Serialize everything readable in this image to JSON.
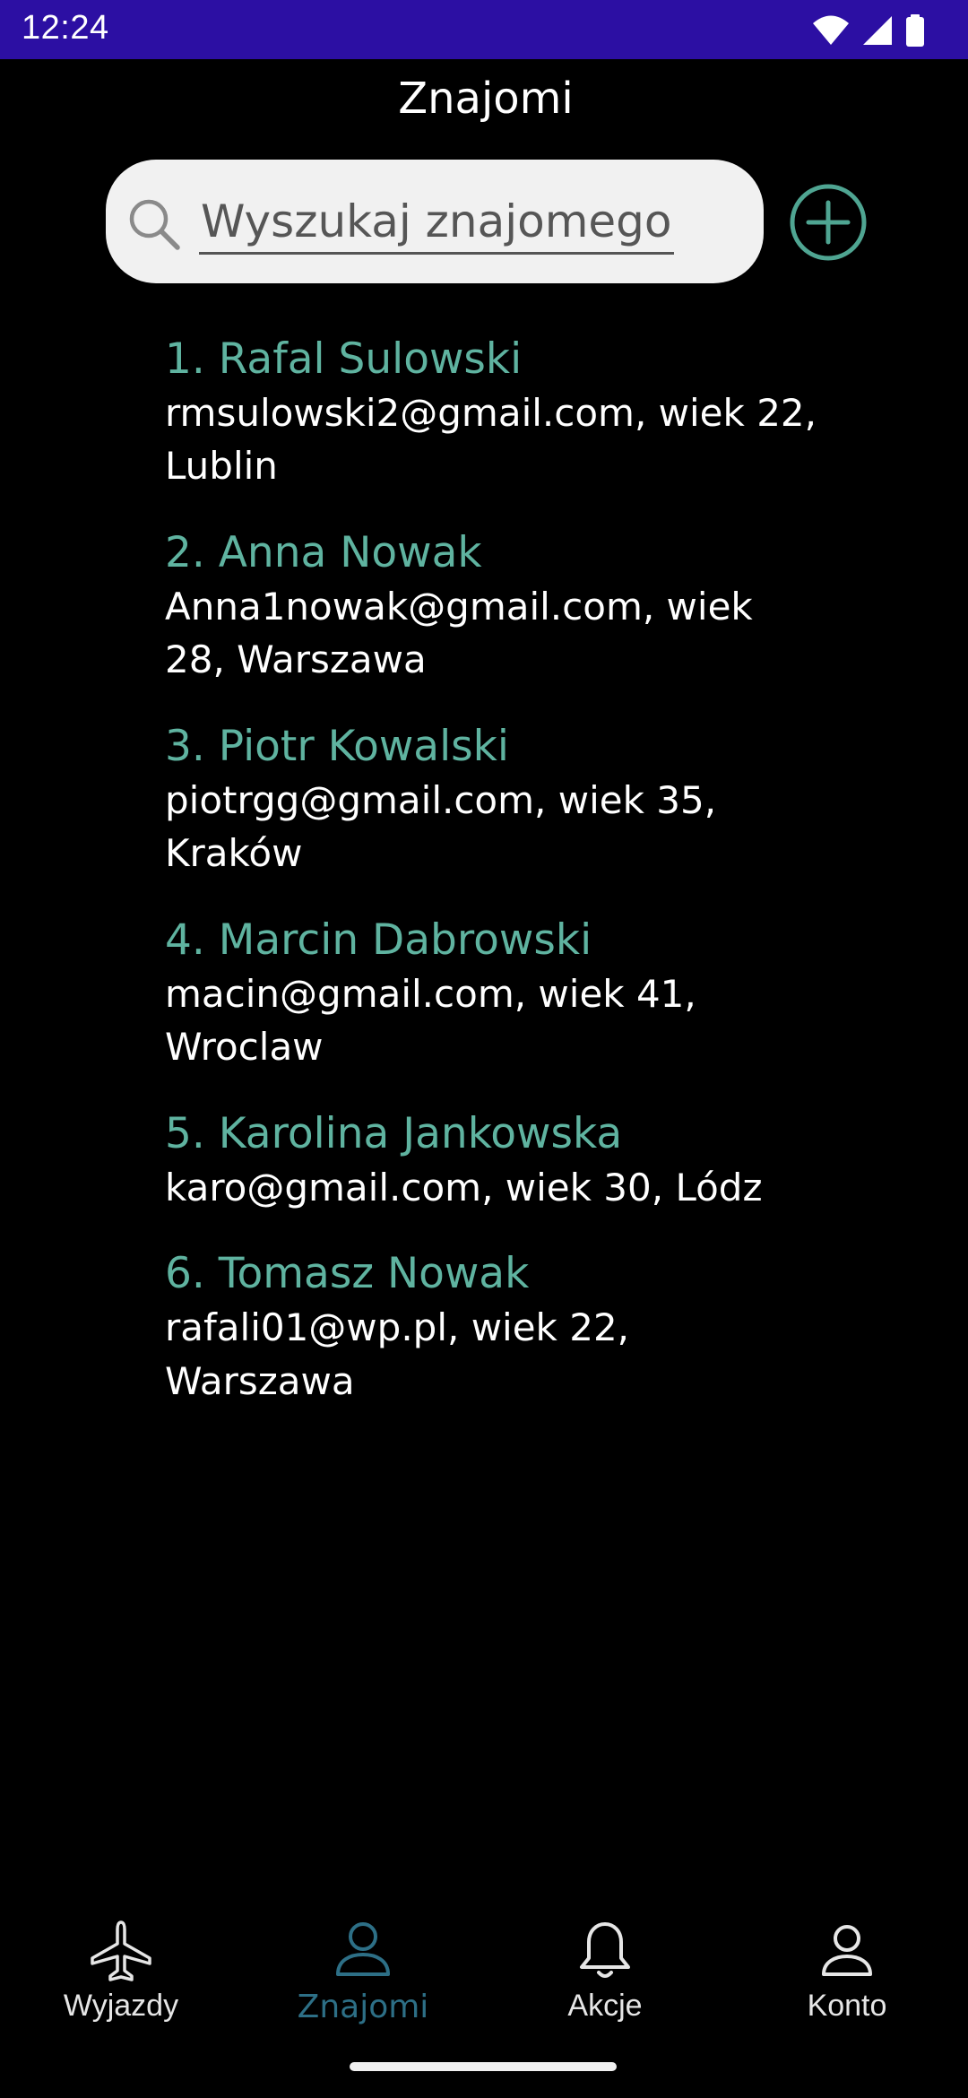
{
  "status_bar": {
    "time": "12:24",
    "background": "#2c0fa3",
    "icons": [
      "wifi-icon",
      "signal-icon",
      "battery-icon"
    ]
  },
  "header": {
    "title": "Znajomi"
  },
  "search": {
    "placeholder": "Wyszukaj znajomego",
    "value": "",
    "icon": "search-icon"
  },
  "add_button": {
    "icon": "add-circle-icon",
    "color": "#4fa592"
  },
  "friends": [
    {
      "name": "1. Rafal Sulowski",
      "details": "rmsulowski2@gmail.com, wiek 22, Lublin"
    },
    {
      "name": "2. Anna Nowak",
      "details": "Anna1nowak@gmail.com, wiek 28, Warszawa"
    },
    {
      "name": "3. Piotr Kowalski",
      "details": "piotrgg@gmail.com, wiek 35, Kraków"
    },
    {
      "name": "4. Marcin Dabrowski",
      "details": "macin@gmail.com, wiek 41, Wroclaw"
    },
    {
      "name": "5. Karolina Jankowska",
      "details": "karo@gmail.com, wiek 30, Lódz"
    },
    {
      "name": "6. Tomasz Nowak",
      "details": "rafali01@wp.pl, wiek 22, Warszawa"
    }
  ],
  "colors": {
    "accent": "#5fb3a0",
    "active_nav": "#2d6f86",
    "background": "#000000"
  },
  "bottom_nav": {
    "items": [
      {
        "label": "Wyjazdy",
        "icon": "airplane-icon",
        "active": false
      },
      {
        "label": "Znajomi",
        "icon": "person-icon",
        "active": true
      },
      {
        "label": "Akcje",
        "icon": "bell-icon",
        "active": false
      },
      {
        "label": "Konto",
        "icon": "account-icon",
        "active": false
      }
    ]
  }
}
